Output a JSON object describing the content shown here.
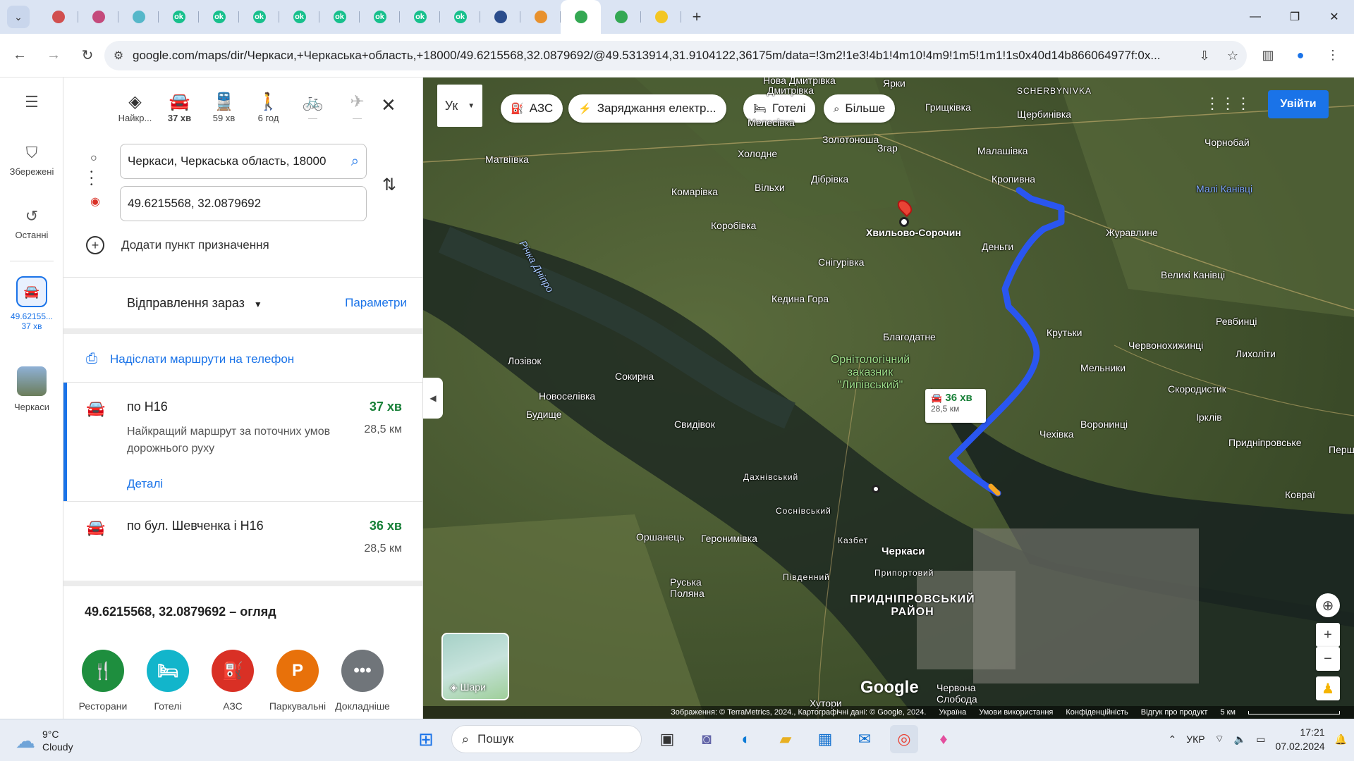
{
  "browser": {
    "tabs": [
      {
        "icon": "home-icon",
        "color": "#d14f4f"
      },
      {
        "icon": "sparkle-icon",
        "color": "#c44a7b"
      },
      {
        "icon": "app-icon",
        "color": "#56b7c9"
      },
      {
        "icon": "ok-icon",
        "color": "#17c08c",
        "text": "ok"
      },
      {
        "icon": "ok-icon",
        "color": "#17c08c",
        "text": "ok"
      },
      {
        "icon": "ok-icon",
        "color": "#17c08c",
        "text": "ok"
      },
      {
        "icon": "ok-icon",
        "color": "#17c08c",
        "text": "ok"
      },
      {
        "icon": "ok-icon",
        "color": "#17c08c",
        "text": "ok"
      },
      {
        "icon": "ok-icon",
        "color": "#17c08c",
        "text": "ok"
      },
      {
        "icon": "ok-icon",
        "color": "#17c08c",
        "text": "ok"
      },
      {
        "icon": "ok-icon",
        "color": "#17c08c",
        "text": "ok"
      },
      {
        "icon": "image-icon",
        "color": "#2a4c8c"
      },
      {
        "icon": "tool-icon",
        "color": "#e8912d"
      },
      {
        "icon": "maps-pin-icon",
        "color": "#34a853",
        "active": true
      },
      {
        "icon": "maps-pin-icon",
        "color": "#34a853"
      },
      {
        "icon": "drive-icon",
        "color": "#f3c623"
      }
    ],
    "url": "google.com/maps/dir/Черкаси,+Черкаська+область,+18000/49.6215568,32.0879692/@49.5313914,31.9104122,36175m/data=!3m2!1e3!4b1!4m10!4m9!1m5!1m1!1s0x40d14b866064977f:0x..."
  },
  "rail": {
    "saved": "Збережені",
    "recent": "Останні",
    "current_route_label": "49.62155...",
    "current_route_time": "37 хв",
    "city": "Черкаси"
  },
  "modes": [
    {
      "label": "Найкр...",
      "icon": "best-route-icon"
    },
    {
      "label": "37 хв",
      "icon": "car-icon",
      "active": true
    },
    {
      "label": "59 хв",
      "icon": "transit-icon"
    },
    {
      "label": "6 год",
      "icon": "walk-icon"
    },
    {
      "label": "—",
      "icon": "bike-icon",
      "disabled": true
    },
    {
      "label": "—",
      "icon": "plane-icon",
      "disabled": true
    }
  ],
  "origin": "Черкаси, Черкаська область, 18000",
  "destination": "49.6215568, 32.0879692",
  "add_destination": "Додати пункт призначення",
  "depart_now": "Відправлення зараз",
  "params": "Параметри",
  "send_to_phone": "Надіслати маршрути на телефон",
  "routes": [
    {
      "name": "по H16",
      "time": "37 хв",
      "dist": "28,5 км",
      "desc": "Найкращий маршрут за поточних умов дорожнього руху",
      "details": "Деталі"
    },
    {
      "name": "по бул. Шевченка і H16",
      "time": "36 хв",
      "dist": "28,5 км"
    }
  ],
  "overview": "49.6215568, 32.0879692 – огляд",
  "categories": [
    {
      "label": "Ресторани",
      "icon": "restaurant-icon",
      "color": "#1e8e3e"
    },
    {
      "label": "Готелі",
      "icon": "hotel-icon",
      "color": "#12b5cb"
    },
    {
      "label": "АЗС",
      "icon": "gas-station-icon",
      "color": "#d93025"
    },
    {
      "label": "Паркувальні",
      "icon": "parking-icon",
      "color": "#e8710a"
    },
    {
      "label": "Докладніше",
      "icon": "more-icon",
      "color": "#70757a"
    }
  ],
  "map": {
    "lang": "Ук",
    "chips": [
      "АЗС",
      "Заряджання електр...",
      "Готелі",
      "Більше"
    ],
    "signin": "Увійти",
    "route_time": "36 хв",
    "route_dist": "28,5 км",
    "layers": "Шари",
    "google": "Google",
    "attribution": "Зображення: © TerraMetrics, 2024., Картографічні дані: © Google, 2024.",
    "links": [
      "Україна",
      "Умови використання",
      "Конфіденційність",
      "Відгук про продукт"
    ],
    "scale": "5 км",
    "labels": [
      "Нова Дмитрівка",
      "Ярки",
      "SCHERBYNIVKA",
      "Грищківка",
      "Щербинівка",
      "Дмитрівка",
      "Мелесівка",
      "Матвіївка",
      "Золотоноша",
      "Холодне",
      "Згар",
      "Малашівка",
      "Чорнобай",
      "Кропивна",
      "Малі Канівці",
      "Дібрівка",
      "Комарівка",
      "Вільхи",
      "Коробівка",
      "Хвильово-Сорочин",
      "Журавлине",
      "Деньги",
      "Снігурівка",
      "Річка Дніпро",
      "Великі Канівці",
      "Кедина Гора",
      "Ревбинці",
      "Благодатне",
      "Крутьки",
      "Лозівок",
      "Червонохижинці",
      "Лихоліти",
      "Орнітологічний заказник \"Липівський\"",
      "Мельники",
      "Сокирна",
      "Новоселівка",
      "Скородистик",
      "Будище",
      "Свидівок",
      "Воронинці",
      "Ірклів",
      "Чехівка",
      "Придніпровське",
      "Дахнівський",
      "Соснівський",
      "Ковраї",
      "Оршанець",
      "Геронимівка",
      "Казбет",
      "Черкаси",
      "Припортовий",
      "Руська Поляна",
      "Південний",
      "ПРИДНІПРОВСЬКИЙ РАЙОН",
      "Хутори",
      "Червона Слобода",
      "Перш"
    ]
  },
  "taskbar": {
    "temp": "9°C",
    "weather": "Cloudy",
    "search": "Пошук",
    "lang": "УКР",
    "time": "17:21",
    "date": "07.02.2024"
  }
}
